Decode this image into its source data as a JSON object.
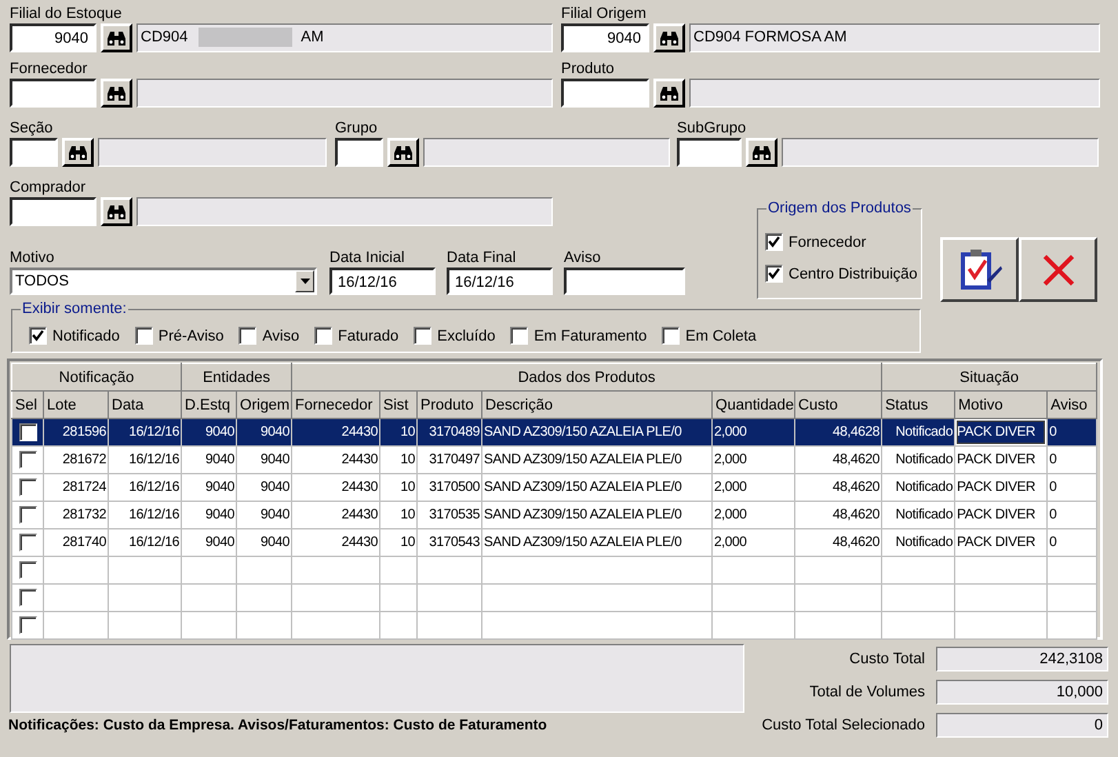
{
  "lookup_rows": [
    [
      {
        "label": "Filial do Estoque",
        "code": "9040",
        "description_parts": [
          "CD904",
          "AM"
        ],
        "redacted": true
      },
      {
        "label": "Filial Origem",
        "code": "9040",
        "description_parts": [
          "CD904 FORMOSA AM"
        ]
      }
    ],
    [
      {
        "label": "Fornecedor"
      },
      {
        "label": "Produto"
      }
    ],
    [
      {
        "label": "Seção"
      },
      {
        "label": "Grupo"
      },
      {
        "label": "SubGrupo"
      }
    ],
    [
      {
        "label": "Comprador"
      }
    ]
  ],
  "motivo": {
    "label": "Motivo",
    "value": "TODOS"
  },
  "dates": [
    {
      "label": "Data Inicial",
      "value": "16/12/16"
    },
    {
      "label": "Data Final",
      "value": "16/12/16"
    },
    {
      "label": "Aviso"
    }
  ],
  "origem": {
    "title": "Origem dos  Produtos",
    "options": [
      {
        "label": "Fornecedor",
        "checked": true
      },
      {
        "label": "Centro Distribuição",
        "checked": true
      }
    ]
  },
  "exibir": {
    "title": "Exibir somente:",
    "options": [
      {
        "label": "Notificado",
        "checked": true
      },
      {
        "label": "Pré-Aviso",
        "checked": false
      },
      {
        "label": "Aviso",
        "checked": false
      },
      {
        "label": "Faturado",
        "checked": false
      },
      {
        "label": "Excluído",
        "checked": false
      },
      {
        "label": "Em Faturamento",
        "checked": false
      },
      {
        "label": "Em Coleta",
        "checked": false
      }
    ]
  },
  "table": {
    "groups": [
      {
        "label": "Notificação"
      },
      {
        "label": "Entidades"
      },
      {
        "label": "Dados dos Produtos"
      },
      {
        "label": "Situação"
      }
    ],
    "columns": [
      "Sel",
      "Lote",
      "Data",
      "D.Estq",
      "Origem",
      "Fornecedor",
      "Sist",
      "Produto",
      "Descrição",
      "Quantidade",
      "Custo",
      "Status",
      "Motivo",
      "Aviso"
    ],
    "rows": [
      {
        "selected": true,
        "checked": false,
        "cells": [
          "281596",
          "16/12/16",
          "9040",
          "9040",
          "24430",
          "10",
          "3170489",
          "SAND AZ309/150 AZALEIA PLE/0",
          "2,000",
          "48,4628",
          "Notificado",
          "PACK DIVER",
          "0"
        ]
      },
      {
        "selected": false,
        "checked": false,
        "cells": [
          "281672",
          "16/12/16",
          "9040",
          "9040",
          "24430",
          "10",
          "3170497",
          "SAND AZ309/150 AZALEIA PLE/0",
          "2,000",
          "48,4620",
          "Notificado",
          "PACK DIVER",
          "0"
        ]
      },
      {
        "selected": false,
        "checked": false,
        "cells": [
          "281724",
          "16/12/16",
          "9040",
          "9040",
          "24430",
          "10",
          "3170500",
          "SAND AZ309/150 AZALEIA PLE/0",
          "2,000",
          "48,4620",
          "Notificado",
          "PACK DIVER",
          "0"
        ]
      },
      {
        "selected": false,
        "checked": false,
        "cells": [
          "281732",
          "16/12/16",
          "9040",
          "9040",
          "24430",
          "10",
          "3170535",
          "SAND AZ309/150 AZALEIA PLE/0",
          "2,000",
          "48,4620",
          "Notificado",
          "PACK DIVER",
          "0"
        ]
      },
      {
        "selected": false,
        "checked": false,
        "cells": [
          "281740",
          "16/12/16",
          "9040",
          "9040",
          "24430",
          "10",
          "3170543",
          "SAND AZ309/150 AZALEIA PLE/0",
          "2,000",
          "48,4620",
          "Notificado",
          "PACK DIVER",
          "0"
        ]
      },
      {
        "selected": false,
        "checked": false
      },
      {
        "selected": false,
        "checked": false
      },
      {
        "selected": false,
        "checked": false
      }
    ]
  },
  "note": "Notificações: Custo da Empresa. Avisos/Faturamentos: Custo de Faturamento",
  "totals": [
    {
      "label": "Custo Total",
      "value": "242,3108"
    },
    {
      "label": "Total de Volumes",
      "value": "10,000"
    },
    {
      "label": "Custo Total Selecionado",
      "value": "0"
    }
  ]
}
